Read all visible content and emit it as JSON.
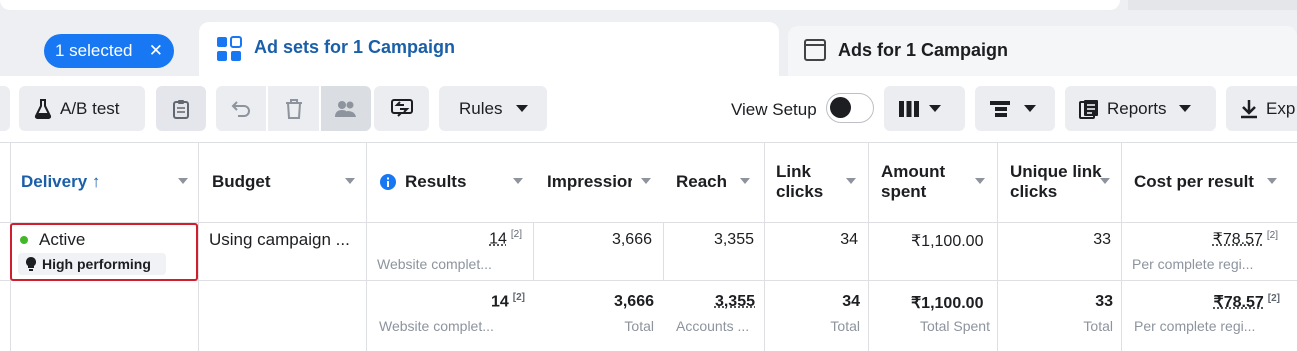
{
  "tabs": {
    "selected_label": "1 selected",
    "selected_clear": "✕",
    "adsets_label": "Ad sets for 1 Campaign",
    "ads_label": "Ads for 1 Campaign"
  },
  "toolbar": {
    "ab_test": "A/B test",
    "rules": "Rules",
    "view_setup": "View Setup",
    "reports": "Reports",
    "export": "Exp"
  },
  "columns": [
    "Delivery ↑",
    "Budget",
    "Results",
    "Impressior",
    "Reach",
    "Link clicks",
    "Amount spent",
    "Unique link clicks",
    "Cost per result"
  ],
  "row": {
    "delivery": "Active",
    "badge": "High performing",
    "budget": "Using campaign ...",
    "results": "14",
    "results_sup": "[2]",
    "results_sub": "Website complet...",
    "impressions": "3,666",
    "reach": "3,355",
    "link_clicks": "34",
    "amount_spent": "₹1,100.00",
    "unique_link_clicks": "33",
    "cost_per_result": "₹78.57",
    "cost_sup": "[2]",
    "cost_sub": "Per complete regi..."
  },
  "totals": {
    "results": "14",
    "results_sup": "[2]",
    "results_sub": "Website complet...",
    "impressions": "3,666",
    "impressions_sub": "Total",
    "reach": "3,355",
    "reach_sub": "Accounts ...",
    "link_clicks": "34",
    "link_clicks_sub": "Total",
    "amount_spent": "₹1,100.00",
    "amount_spent_sub": "Total Spent",
    "unique_link_clicks": "33",
    "unique_link_clicks_sub": "Total",
    "cost_per_result": "₹78.57",
    "cost_sup": "[2]",
    "cost_sub": "Per complete regi..."
  },
  "colors": {
    "accent": "#1877f2",
    "tab_text": "#1b5fa8",
    "highlight": "#d01e2f",
    "active": "#42b72a"
  }
}
